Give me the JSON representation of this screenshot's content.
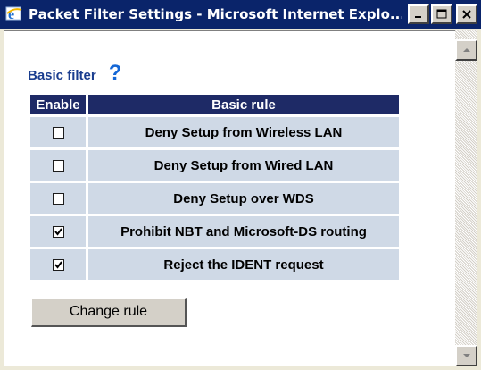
{
  "window": {
    "title": "Packet Filter Settings - Microsoft Internet Explo...",
    "icon": "internet-explorer-icon"
  },
  "section": {
    "heading": "Basic filter",
    "help_label": "?"
  },
  "table": {
    "headers": {
      "enable": "Enable",
      "rule": "Basic rule"
    },
    "rows": [
      {
        "label": "Deny Setup from Wireless LAN",
        "checked": false
      },
      {
        "label": "Deny Setup from Wired LAN",
        "checked": false
      },
      {
        "label": "Deny Setup over WDS",
        "checked": false
      },
      {
        "label": "Prohibit NBT and Microsoft-DS routing",
        "checked": true
      },
      {
        "label": "Reject the IDENT request",
        "checked": true
      }
    ]
  },
  "buttons": {
    "change_rule": "Change rule"
  },
  "colors": {
    "titlebar": "#0a246a",
    "table_header": "#1e2a66",
    "row_bg": "#cfd9e6",
    "heading": "#1a3d8f",
    "help": "#1467d6"
  }
}
